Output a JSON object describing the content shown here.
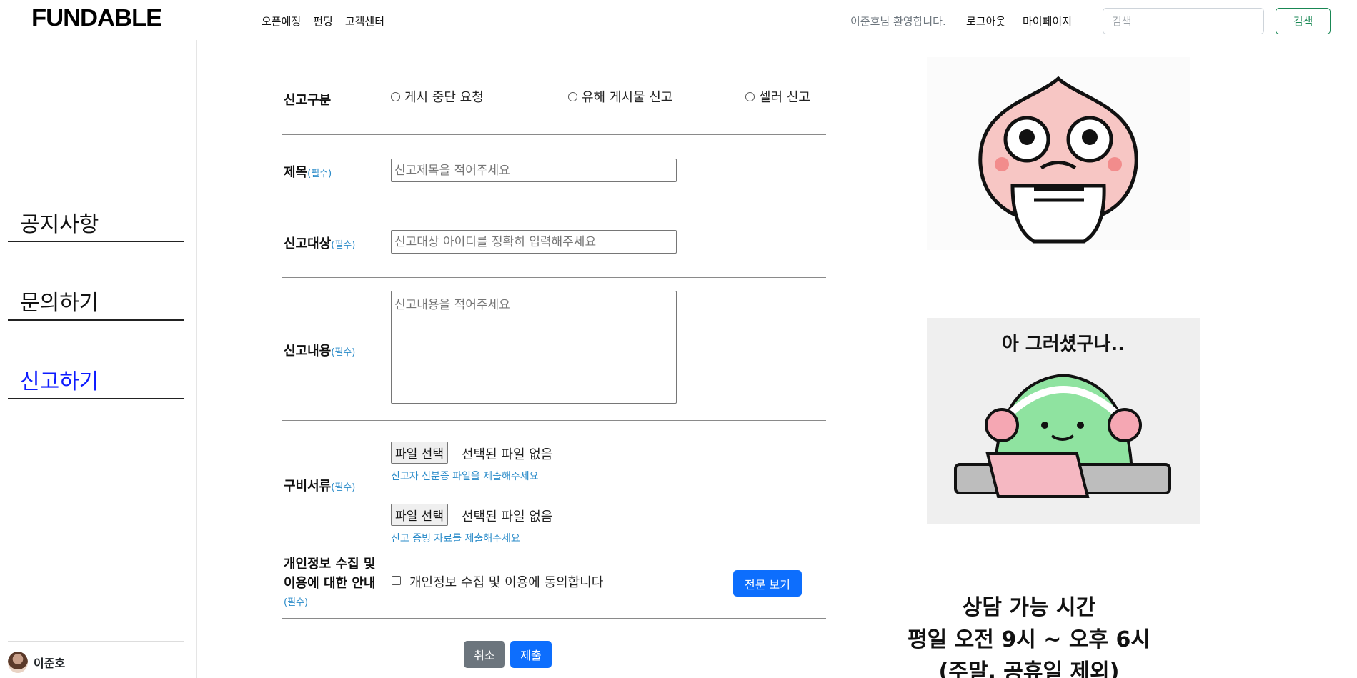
{
  "header": {
    "logo": "FUNDABLE",
    "nav": [
      "오픈예정",
      "펀딩",
      "고객센터"
    ],
    "welcome": "이준호님 환영합니다.",
    "logout": "로그아웃",
    "mypage": "마이페이지",
    "search_placeholder": "검색",
    "search_button": "검색"
  },
  "sidebar": {
    "items": [
      {
        "label": "공지사항",
        "active": false
      },
      {
        "label": "문의하기",
        "active": false
      },
      {
        "label": "신고하기",
        "active": true
      }
    ],
    "user": "이준호"
  },
  "form": {
    "report_type": {
      "label": "신고구분",
      "options": [
        "게시 중단 요청",
        "유해 게시물 신고",
        "셀러 신고"
      ]
    },
    "required_text": "(필수)",
    "title": {
      "label": "제목",
      "placeholder": "신고제목을 적어주세요"
    },
    "target": {
      "label": "신고대상",
      "placeholder": "신고대상 아이디를 정확히 입력해주세요"
    },
    "content": {
      "label": "신고내용",
      "placeholder": "신고내용을 적어주세요"
    },
    "documents": {
      "label": "구비서류",
      "file_button": "파일 선택",
      "file_status": "선택된 파일 없음",
      "hint1": "신고자 신분증 파일을 제출해주세요",
      "hint2": "신고 증빙 자료를 제출해주세요"
    },
    "privacy": {
      "label_line1": "개인정보 수집 및",
      "label_line2": "이용에 대한 안내",
      "checkbox_label": "개인정보 수집 및 이용에 동의합니다",
      "view_button": "전문 보기"
    },
    "cancel_button": "취소",
    "submit_button": "제출"
  },
  "right": {
    "sticker2_text": "아 그러셨구나..",
    "hours_line1": "상담 가능 시간",
    "hours_line2": "평일 오전 9시 ~ 오후 6시",
    "hours_line3": "(주말, 공휴일 제외)"
  }
}
